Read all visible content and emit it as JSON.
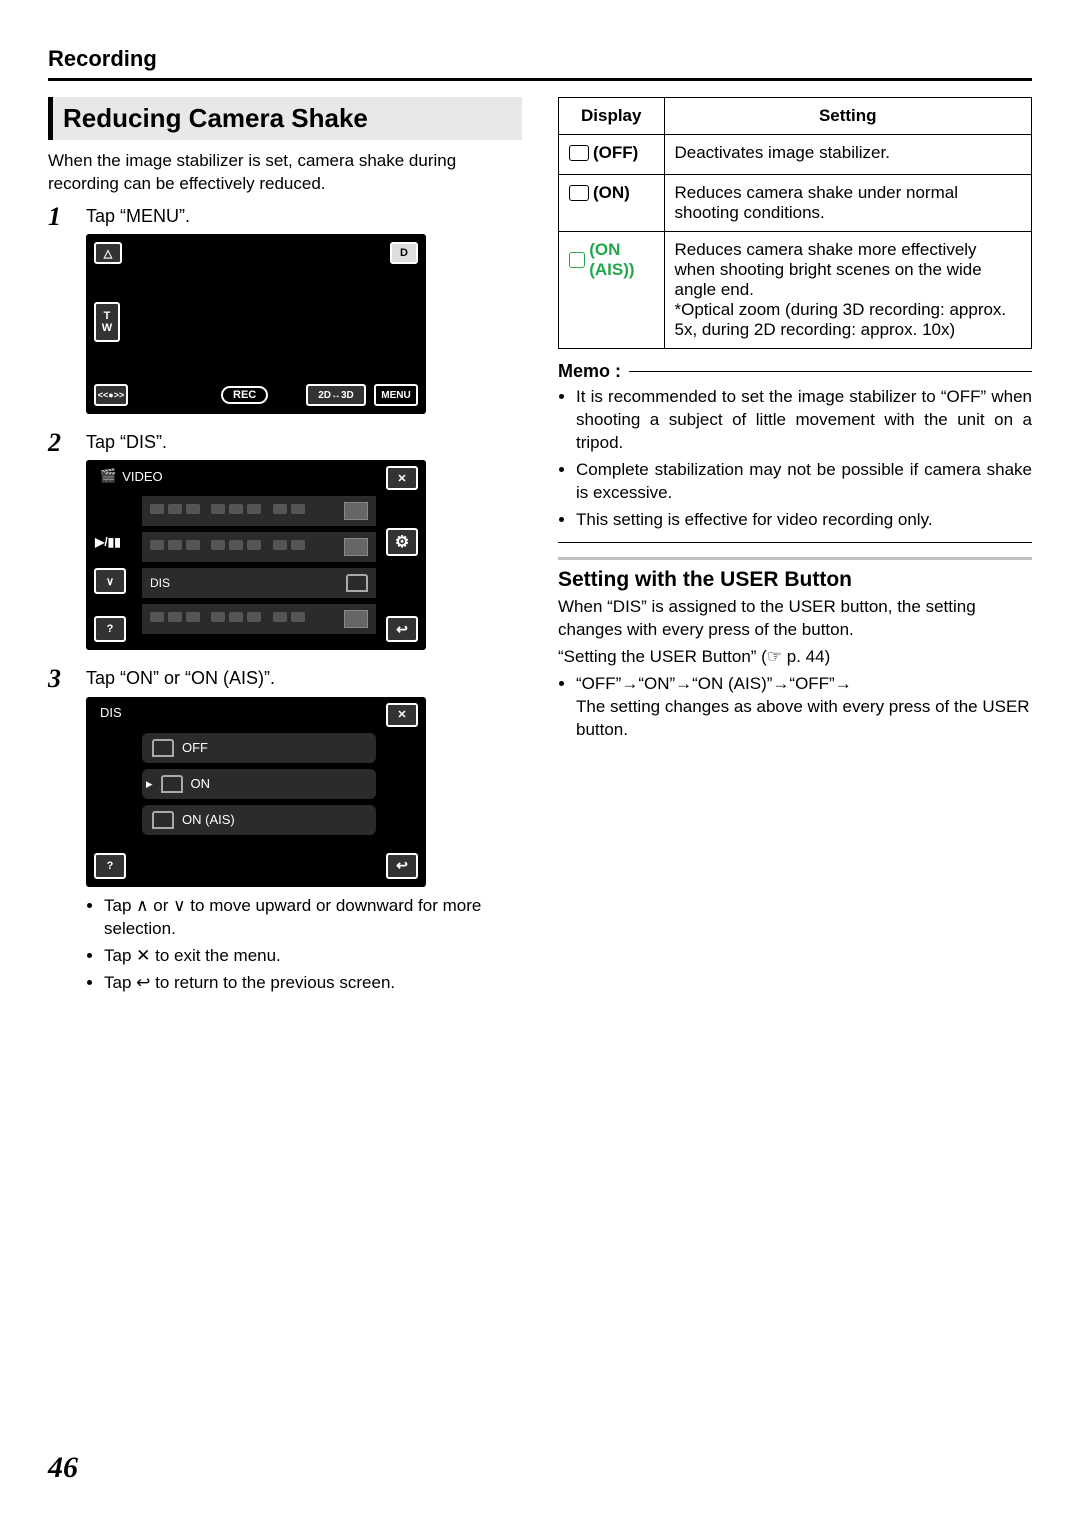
{
  "chapter": "Recording",
  "page_number": "46",
  "left": {
    "heading": "Reducing Camera Shake",
    "intro": "When the image stabilizer is set, camera shake during recording can be effectively reduced.",
    "steps": [
      {
        "num": "1",
        "text": "Tap “MENU”.",
        "screen": {
          "type": "rec",
          "top_left": "△",
          "top_right": "D",
          "zoom_t": "T",
          "zoom_w": "W",
          "shutter": "<<●>>",
          "rec_btn": "REC",
          "mode_btn": "2D↔3D",
          "menu_btn": "MENU"
        }
      },
      {
        "num": "2",
        "text": "Tap “DIS”.",
        "screen": {
          "type": "video_menu",
          "title": "VIDEO",
          "close": "✕",
          "gear": "⚙",
          "back": "↩",
          "help": "?",
          "playpause": "▶/▮▮",
          "down": "∨",
          "row_label": "DIS"
        }
      },
      {
        "num": "3",
        "text": "Tap “ON” or “ON (AIS)”.",
        "screen": {
          "type": "dis_menu",
          "title": "DIS",
          "close": "✕",
          "back": "↩",
          "help": "?",
          "options": [
            "OFF",
            "ON",
            "ON (AIS)"
          ]
        },
        "notes": [
          "Tap ∧ or ∨ to move upward or downward for more selection.",
          "Tap ✕ to exit the menu.",
          "Tap ↩ to return to the previous screen."
        ]
      }
    ]
  },
  "right": {
    "table": {
      "headers": [
        "Display",
        "Setting"
      ],
      "rows": [
        {
          "display": "(OFF)",
          "setting": "Deactivates image stabilizer."
        },
        {
          "display": "(ON)",
          "setting": "Reduces camera shake under normal shooting conditions."
        },
        {
          "display": "(ON (AIS))",
          "ais": true,
          "setting": "Reduces camera shake more effectively when shooting bright scenes on the wide angle end.\n*Optical zoom (during 3D recording: approx. 5x, during 2D recording: approx. 10x)"
        }
      ]
    },
    "memo_label": "Memo :",
    "memo_items": [
      "It is recommended to set the image stabilizer to “OFF” when shooting a subject of little movement with the unit on a tripod.",
      "Complete stabilization may not be possible if camera shake is excessive.",
      "This setting is effective for video recording only."
    ],
    "user_button": {
      "heading": "Setting with the USER Button",
      "para1": "When “DIS” is assigned to the USER button, the setting changes with every press of the button.",
      "ref": "“Setting the USER Button” (☞ p. 44)",
      "cycle": "“OFF”→“ON”→“ON (AIS)”→“OFF”→",
      "cycle_desc": "The setting changes as above with every press of the USER button."
    }
  }
}
